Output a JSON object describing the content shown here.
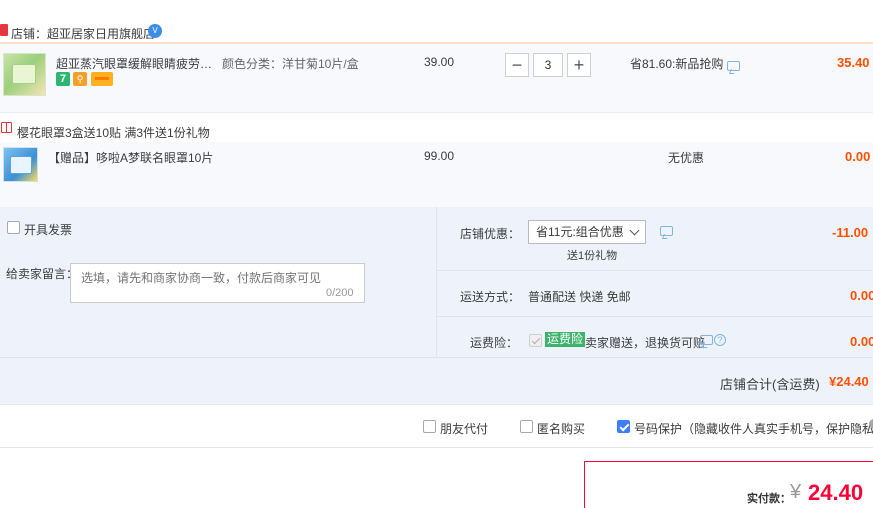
{
  "store": {
    "label": "店铺：",
    "name": "超亚居家日用旗舰店",
    "badge": "V"
  },
  "items": [
    {
      "title": "超亚蒸汽眼罩缓解眼睛疲劳热敷...",
      "sku": "颜色分类：洋甘菊10片/盒",
      "price": "39.00",
      "quantity": "3",
      "promo": "省81.60:新品抢购",
      "total": "35.40",
      "tags": [
        "7",
        "shield",
        "card"
      ]
    },
    {
      "title": "【赠品】哆啦A梦联名眼罩10片",
      "price": "99.00",
      "promo": "无优惠",
      "total": "0.00"
    }
  ],
  "gift_promo": "樱花眼罩3盒送10贴   满3件送1份礼物",
  "invoice": {
    "label": "开具发票",
    "checked": false
  },
  "message": {
    "label": "给卖家留言：",
    "placeholder": "选填，请先和商家协商一致，付款后商家可见",
    "count": "0/200"
  },
  "store_discount": {
    "label": "店铺优惠：",
    "selected": "省11元:组合优惠",
    "gift": "送1份礼物",
    "amount": "-11.00"
  },
  "shipping": {
    "label": "运送方式：",
    "method": "普通配送 快递 免邮",
    "amount": "0.00"
  },
  "insurance": {
    "label": "运费险：",
    "tag": "运费险",
    "desc": "卖家赠送，退换货可赔",
    "amount": "0.00"
  },
  "store_total": {
    "label": "店铺合计(含运费)",
    "amount": "¥24.40"
  },
  "options": [
    {
      "label": "朋友代付",
      "checked": false
    },
    {
      "label": "匿名购买",
      "checked": false
    },
    {
      "label": "号码保护（隐藏收件人真实手机号，保护隐私）",
      "checked": true
    }
  ],
  "payment": {
    "label": "实付款：",
    "currency": "¥",
    "amount": "24.40"
  },
  "colors": {
    "accent_orange": "#ff5000",
    "accent_red": "#ff0036",
    "panel_blue": "#eef3fb",
    "checkbox_blue": "#3d7eff",
    "insurance_green": "#3bb36b"
  }
}
